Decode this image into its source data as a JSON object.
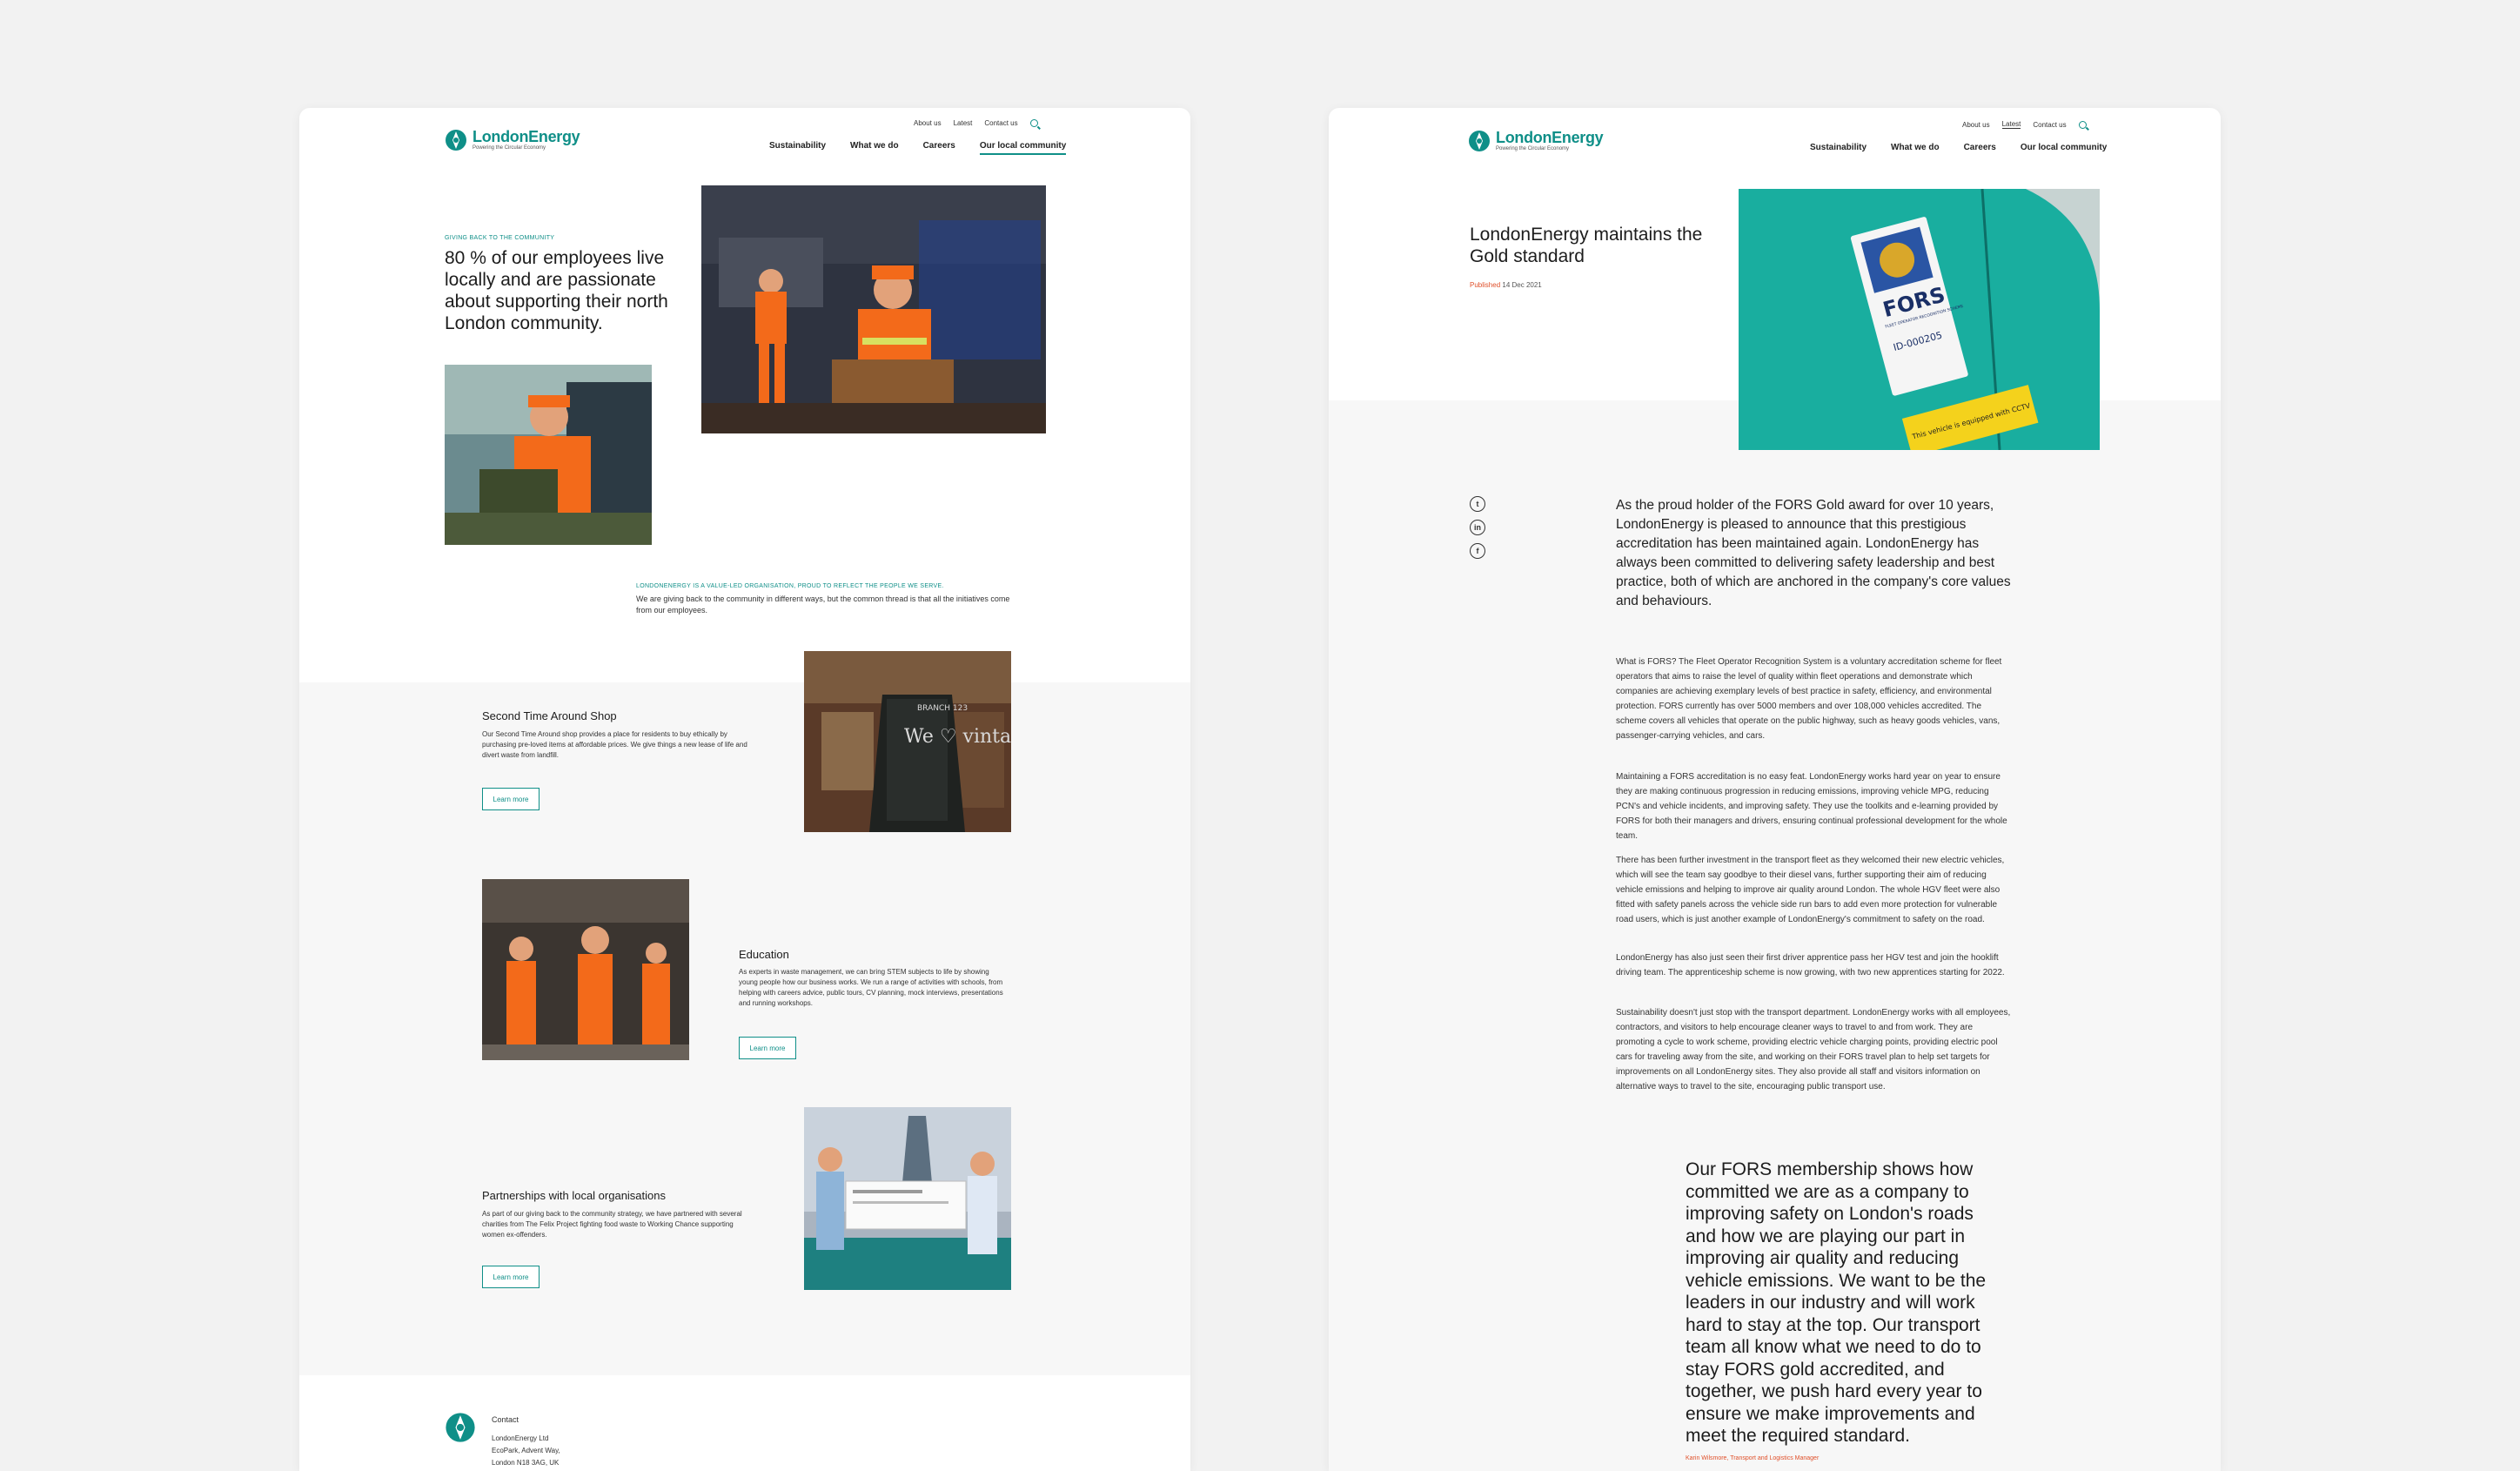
{
  "brand": {
    "name": "LondonEnergy",
    "tagline": "Powering the Circular Economy",
    "accent": "#0f8f88",
    "highlight": "#e0502a"
  },
  "util_nav": [
    "About us",
    "Latest",
    "Contact us"
  ],
  "main_nav": [
    "Sustainability",
    "What we do",
    "Careers",
    "Our local community"
  ],
  "left_page": {
    "eyebrow": "GIVING BACK TO THE COMMUNITY",
    "headline": "80 % of our employees live locally and are passionate about supporting their north London community.",
    "intro_eyebrow": "LONDONENERGY IS A VALUE-LED ORGANISATION, PROUD TO REFLECT THE PEOPLE WE SERVE.",
    "intro_text": "We are giving back to the community in different ways, but the common thread is that all the initiatives come from our employees.",
    "sections": [
      {
        "title": "Second Time Around Shop",
        "text": "Our Second Time Around shop provides a place for residents to buy ethically by purchasing pre-loved items at affordable prices. We give things a new lease of life and divert waste from landfill.",
        "button": "Learn more"
      },
      {
        "title": "Education",
        "text": "As experts in waste management, we can bring STEM subjects to life by showing young people how our business works. We run a range of activities with schools, from helping with careers advice, public tours, CV planning, mock interviews, presentations and running workshops.",
        "button": "Learn more"
      },
      {
        "title": "Partnerships with local organisations",
        "text": "As part of our giving back to the community strategy, we have partnered with several charities from The Felix Project fighting food waste to Working Chance supporting women ex-offenders.",
        "button": "Learn more"
      }
    ],
    "chalkboard_text": "We ♡ vintage",
    "chalkboard_corner": "BRANCH 123",
    "contact": {
      "label": "Contact",
      "lines": [
        "LondonEnergy Ltd",
        "EcoPark, Advent Way,",
        "London N18 3AG, UK"
      ]
    }
  },
  "right_page": {
    "title": "LondonEnergy maintains the Gold standard",
    "published_label": "Published",
    "published_date": "14 Dec 2021",
    "fors_badge": {
      "line1": "FORS",
      "line2": "FLEET OPERATOR RECOGNITION SCHEME",
      "line3": "ID-000205",
      "sticker": "This vehicle is equipped with CCTV"
    },
    "social": [
      "twitter-icon",
      "linkedin-icon",
      "facebook-icon"
    ],
    "lead": "As the proud holder of the FORS Gold award for over 10 years, LondonEnergy is pleased to announce that this prestigious accreditation has been maintained again. LondonEnergy has always been committed to delivering safety leadership and best practice, both of which are anchored in the company's core values and behaviours.",
    "paragraphs": [
      "What is FORS? The Fleet Operator Recognition System is a voluntary accreditation scheme for fleet operators that aims to raise the level of quality within fleet operations and demonstrate which companies are achieving exemplary levels of best practice in safety, efficiency, and environmental protection. FORS currently has over 5000 members and over 108,000 vehicles accredited. The scheme covers all vehicles that operate on the public highway, such as heavy goods vehicles, vans, passenger-carrying vehicles, and cars.",
      "Maintaining a FORS accreditation is no easy feat. LondonEnergy works hard year on year to ensure they are making continuous progression in reducing emissions, improving vehicle MPG, reducing PCN's and vehicle incidents, and improving safety. They use the toolkits and e-learning provided by FORS for both their managers and drivers, ensuring continual professional development for the whole team.",
      "There has been further investment in the transport fleet as they welcomed their new electric vehicles, which will see the team say goodbye to their diesel vans, further supporting their aim of reducing vehicle emissions and helping to improve air quality around London. The whole HGV fleet were also fitted with safety panels across the vehicle side run bars to add even more protection for vulnerable road users, which is just another example of LondonEnergy's commitment to safety on the road.",
      "LondonEnergy has also just seen their first driver apprentice pass her HGV test and join the hooklift driving team. The apprenticeship scheme is now growing, with two new apprentices starting for 2022.",
      "Sustainability doesn't just stop with the transport department. LondonEnergy works with all employees, contractors, and visitors to help encourage cleaner ways to travel to and from work. They are promoting a cycle to work scheme, providing electric vehicle charging points, providing electric pool cars for traveling away from the site, and working on their FORS travel plan to help set targets for improvements on all LondonEnergy sites. They also provide all staff and visitors information on alternative ways to travel to the site, encouraging public transport use."
    ],
    "quote": "Our FORS membership shows how committed we are as a company to improving safety on London's roads and how we are playing our part in improving air quality and reducing vehicle emissions. We want to be the leaders in our industry and will work hard to stay at the top. Our transport team all know what we need to do to stay FORS gold accredited, and together, we push hard every year to ensure we make improvements and meet the required standard.",
    "quote_cite": "Karin Wilsmore, Transport and Logistics Manager"
  }
}
